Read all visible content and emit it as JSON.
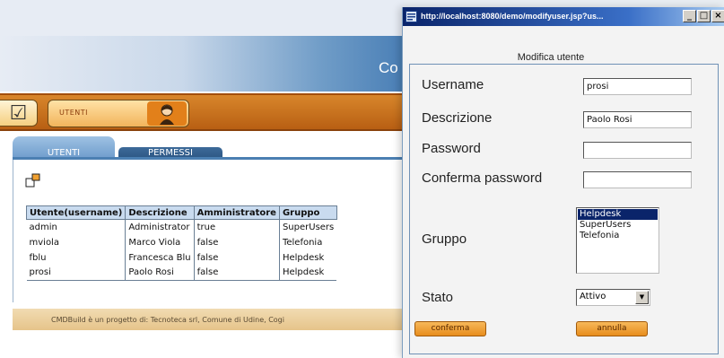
{
  "app": {
    "banner_text": "Co",
    "toolbar": {
      "module_label": "UTENTI"
    },
    "tabs": [
      {
        "label": "UTENTI"
      },
      {
        "label": "PERMESSI"
      }
    ],
    "table": {
      "headers": [
        "Utente(username)",
        "Descrizione",
        "Amministratore",
        "Gruppo"
      ],
      "rows": [
        [
          "admin",
          "Administrator",
          "true",
          "SuperUsers"
        ],
        [
          "mviola",
          "Marco Viola",
          "false",
          "Telefonia"
        ],
        [
          "fblu",
          "Francesca Blu",
          "false",
          "Helpdesk"
        ],
        [
          "prosi",
          "Paolo Rosi",
          "false",
          "Helpdesk"
        ]
      ]
    },
    "footer": "CMDBuild è un progetto di: Tecnoteca srl, Comune di Udine, Cogi"
  },
  "popup": {
    "title": "http://localhost:8080/demo/modifyuser.jsp?us...",
    "form_title": "Modifica utente",
    "fields": {
      "username": {
        "label": "Username",
        "value": "prosi"
      },
      "descrizione": {
        "label": "Descrizione",
        "value": "Paolo Rosi"
      },
      "password": {
        "label": "Password",
        "value": ""
      },
      "conferma": {
        "label": "Conferma password",
        "value": ""
      },
      "gruppo": {
        "label": "Gruppo",
        "options": [
          "Helpdesk",
          "SuperUsers",
          "Telefonia"
        ],
        "selected": "Helpdesk"
      },
      "stato": {
        "label": "Stato",
        "value": "Attivo"
      }
    },
    "buttons": {
      "confirm": "conferma",
      "cancel": "annulla"
    }
  },
  "colors": {
    "accent_orange": "#d8862b",
    "tab_blue": "#6c9acb",
    "selection": "#0a246a"
  }
}
